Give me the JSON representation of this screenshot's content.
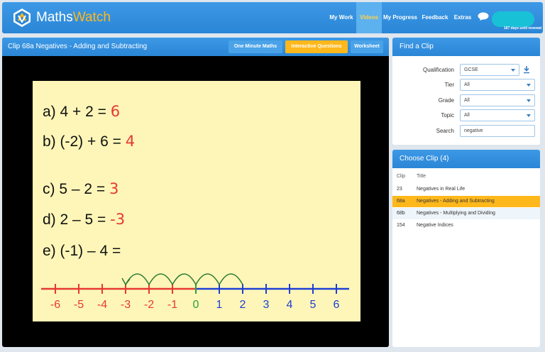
{
  "brand": {
    "name_part1": "Maths",
    "name_part2": "Watch",
    "accent": "#ffb81c",
    "blue": "#2a86d6"
  },
  "nav": {
    "items": [
      {
        "label": "My Work",
        "active": false
      },
      {
        "label": "Videos",
        "active": true
      },
      {
        "label": "My Progress",
        "active": false
      },
      {
        "label": "Feedback",
        "active": false
      },
      {
        "label": "Extras",
        "active": false
      }
    ],
    "renewal_text": "187 days until renewal"
  },
  "video": {
    "clip_title": "Clip 68a Negatives - Adding and Subtracting",
    "tabs": [
      {
        "label": "One Minute Maths",
        "active": false
      },
      {
        "label": "Interactive Questions",
        "active": true
      },
      {
        "label": "Worksheet",
        "active": false
      }
    ],
    "board": {
      "equations": [
        {
          "text": "a)  4 + 2 =",
          "answer": "6"
        },
        {
          "text": "b)  (-2) + 6 =",
          "answer": "4"
        },
        {
          "text": "c)  5 – 2 =",
          "answer": "3"
        },
        {
          "text": "d)  2 – 5 =",
          "answer": "-3"
        },
        {
          "text": "e)  (-1) – 4 =",
          "answer": ""
        }
      ],
      "number_line": {
        "ticks": [
          "-6",
          "-5",
          "-4",
          "-3",
          "-2",
          "-1",
          "0",
          "1",
          "2",
          "3",
          "4",
          "5",
          "6"
        ],
        "negative_color": "#e53935",
        "zero_color": "#2e9e3e",
        "positive_color": "#1e3fd4",
        "arrow_color": "#2e7d32"
      }
    }
  },
  "find_clip": {
    "title": "Find a Clip",
    "fields": [
      {
        "label": "Qualification",
        "value": "GCSE",
        "type": "select"
      },
      {
        "label": "Tier",
        "value": "All",
        "type": "select"
      },
      {
        "label": "Grade",
        "value": "All",
        "type": "select"
      },
      {
        "label": "Topic",
        "value": "All",
        "type": "select"
      },
      {
        "label": "Search",
        "value": "negative",
        "type": "text"
      }
    ]
  },
  "choose_clip": {
    "title": "Choose Clip (4)",
    "columns": [
      "Clip",
      "Title"
    ],
    "rows": [
      {
        "clip": "23",
        "title": "Negatives in Real Life",
        "selected": false
      },
      {
        "clip": "68a",
        "title": "Negatives - Adding and Subtracting",
        "selected": true
      },
      {
        "clip": "68b",
        "title": "Negatives - Multiplying and Dividing",
        "selected": false
      },
      {
        "clip": "154",
        "title": "Negative Indices",
        "selected": false
      }
    ]
  }
}
